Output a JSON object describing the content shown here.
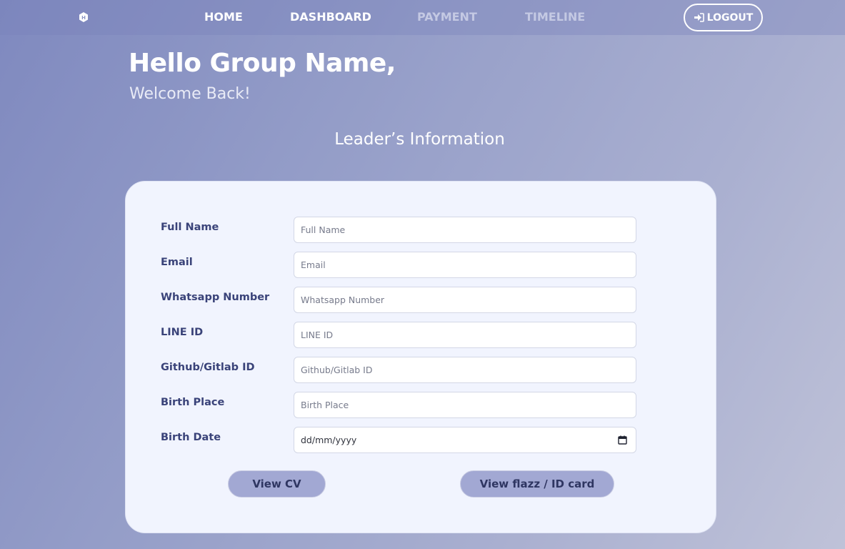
{
  "nav": {
    "logo_icon": "hexagon-logo-icon",
    "links": [
      {
        "label": "HOME",
        "active": true
      },
      {
        "label": "DASHBOARD",
        "active": true
      },
      {
        "label": "PAYMENT",
        "active": false
      },
      {
        "label": "TIMELINE",
        "active": false
      }
    ],
    "logout_label": "LOGOUT",
    "logout_icon": "sign-in-icon"
  },
  "header": {
    "greeting": "Hello Group Name,",
    "welcome": "Welcome Back!"
  },
  "section": {
    "title": "Leader’s Information"
  },
  "form": {
    "fields": [
      {
        "label": "Full Name",
        "placeholder": "Full Name"
      },
      {
        "label": "Email",
        "placeholder": "Email"
      },
      {
        "label": "Whatsapp Number",
        "placeholder": "Whatsapp Number"
      },
      {
        "label": "LINE ID",
        "placeholder": "LINE ID"
      },
      {
        "label": "Github/Gitlab ID",
        "placeholder": "Github/Gitlab ID"
      },
      {
        "label": "Birth Place",
        "placeholder": "Birth Place"
      },
      {
        "label": "Birth Date",
        "value": "dd/mm/yyyy",
        "icon": "calendar-icon"
      }
    ],
    "view_cv_label": "View CV",
    "view_id_label": "View flazz / ID card"
  },
  "colors": {
    "accent": "#a2a8d3",
    "label_text": "#3a4379",
    "card_bg": "#f1f4fe"
  }
}
